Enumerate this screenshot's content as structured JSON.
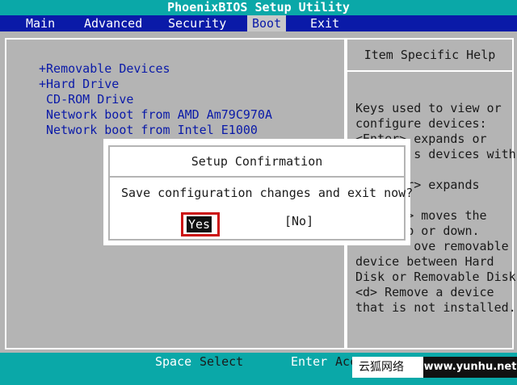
{
  "title": "PhoenixBIOS Setup Utility",
  "menu": {
    "items": [
      "Main",
      "Advanced",
      "Security",
      "Boot",
      "Exit"
    ],
    "active": "Boot"
  },
  "boot_list": [
    "+Removable Devices",
    "+Hard Drive",
    " CD-ROM Drive",
    " Network boot from AMD Am79C970A",
    " Network boot from Intel E1000"
  ],
  "help": {
    "title": "Item Specific Help",
    "lines": [
      "Keys used to view or",
      "configure devices:",
      "<Enter> expands or",
      "        s devices with",
      "",
      "     ter> expands",
      "",
      "     <-> moves the",
      "       p or down.",
      "        ove removable",
      "device between Hard",
      "Disk or Removable Disk",
      "<d> Remove a device",
      "that is not installed."
    ]
  },
  "dialog": {
    "title": "Setup Confirmation",
    "message": "Save configuration changes and exit now?",
    "yes_label": "Yes",
    "no_label": "[No]"
  },
  "status": {
    "space": "Space",
    "select": "Select",
    "enter": "Enter",
    "acc": "Acc"
  },
  "watermark": {
    "left": "云狐网络",
    "right": "www.yunhu.net"
  }
}
